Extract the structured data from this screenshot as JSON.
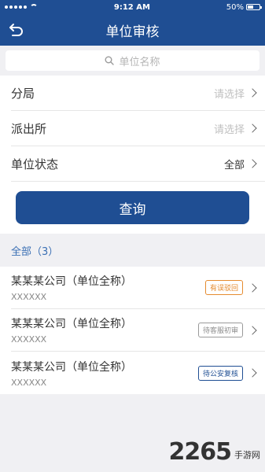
{
  "status_bar": {
    "time": "9:12 AM",
    "battery": "50%",
    "battery_level": 0.5
  },
  "header": {
    "title": "单位审核",
    "back_icon": "back-arrow-icon"
  },
  "search": {
    "placeholder": "单位名称"
  },
  "filters": [
    {
      "label": "分局",
      "value": "请选择",
      "is_placeholder": true
    },
    {
      "label": "派出所",
      "value": "请选择",
      "is_placeholder": true
    },
    {
      "label": "单位状态",
      "value": "全部",
      "is_placeholder": false
    }
  ],
  "query_button": "查询",
  "results": {
    "heading": "全部（3）",
    "items": [
      {
        "title": "某某某公司（单位全称）",
        "sub": "XXXXXX",
        "status": "有误驳回",
        "status_color": "#e58b2f"
      },
      {
        "title": "某某某公司（单位全称）",
        "sub": "XXXXXX",
        "status": "待客服初审",
        "status_color": "#8c8c8c"
      },
      {
        "title": "某某某公司（单位全称）",
        "sub": "XXXXXX",
        "status": "待公安复核",
        "status_color": "#1f4e93"
      }
    ]
  },
  "watermark": {
    "number": "2265",
    "text": "手游网"
  },
  "colors": {
    "primary": "#1f4e93",
    "background": "#f0f0f3"
  }
}
